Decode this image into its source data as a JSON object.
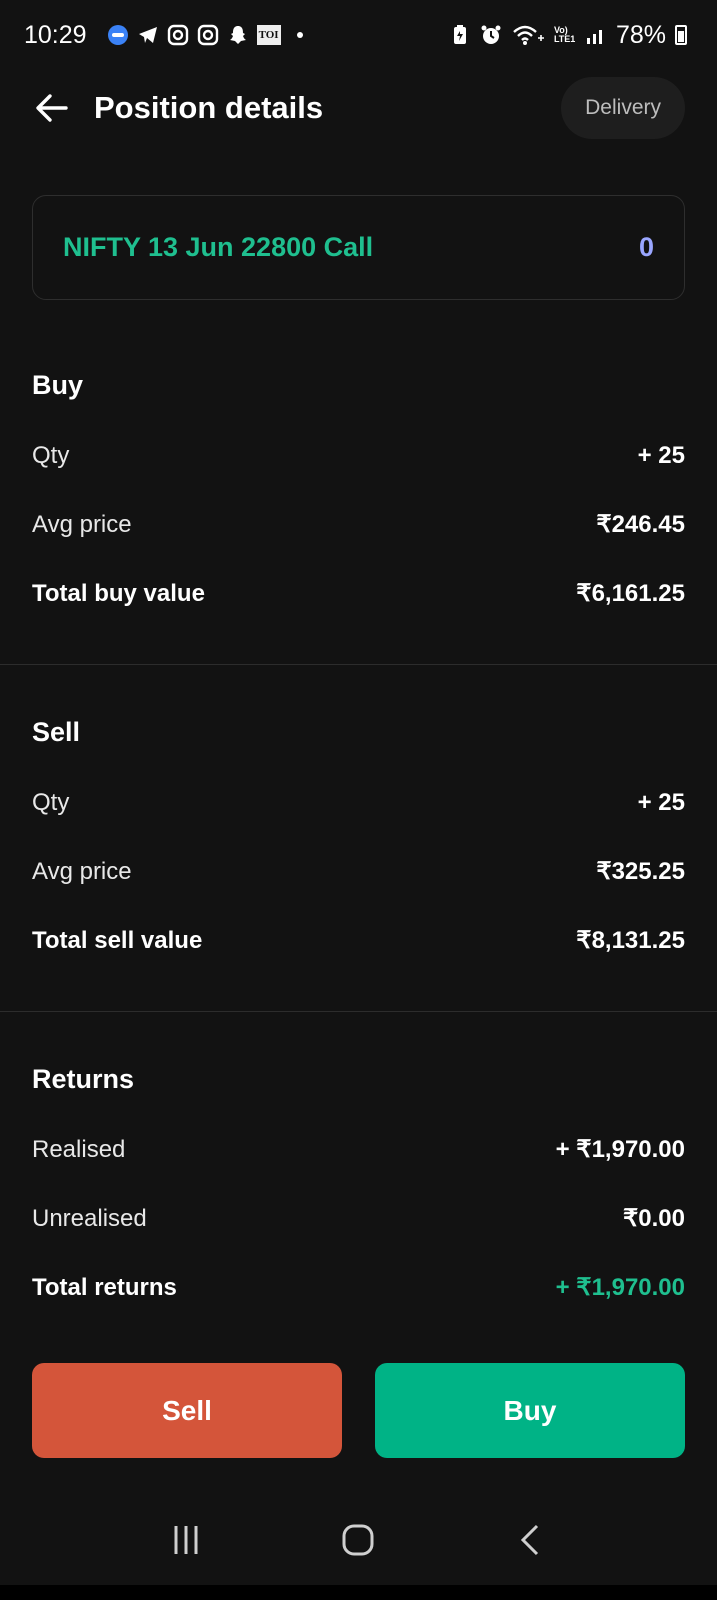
{
  "status_bar": {
    "time": "10:29",
    "battery": "78%",
    "network": "Vo) LTE1",
    "app_icons": [
      "messages-icon",
      "telegram-icon",
      "instagram-icon",
      "instagram-icon",
      "snapchat-icon",
      "toi-icon"
    ],
    "toi_label": "TOI"
  },
  "header": {
    "title": "Position details",
    "chip": "Delivery"
  },
  "instrument": {
    "name": "NIFTY 13 Jun 22800 Call",
    "net_qty": "0"
  },
  "buy": {
    "heading": "Buy",
    "rows": [
      {
        "label": "Qty",
        "value": "+ 25"
      },
      {
        "label": "Avg price",
        "value": "₹246.45"
      },
      {
        "label": "Total buy value",
        "value": "₹6,161.25"
      }
    ]
  },
  "sell": {
    "heading": "Sell",
    "rows": [
      {
        "label": "Qty",
        "value": "+ 25"
      },
      {
        "label": "Avg price",
        "value": "₹325.25"
      },
      {
        "label": "Total sell value",
        "value": "₹8,131.25"
      }
    ]
  },
  "returns": {
    "heading": "Returns",
    "rows": [
      {
        "label": "Realised",
        "value": "+ ₹1,970.00"
      },
      {
        "label": "Unrealised",
        "value": "₹0.00"
      },
      {
        "label": "Total returns",
        "value": "+ ₹1,970.00"
      }
    ]
  },
  "actions": {
    "sell_label": "Sell",
    "buy_label": "Buy"
  },
  "colors": {
    "accent_green": "#1fbf8f",
    "sell_red": "#d4553a",
    "buy_green": "#00b386",
    "qty_blue": "#9aa6ff"
  }
}
